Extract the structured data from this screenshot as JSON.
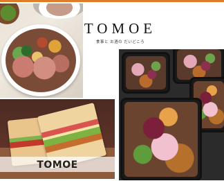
{
  "brand": {
    "name": "TOMOE",
    "tagline": "食事と お酒の だいどころ",
    "accent": "#e07b27"
  },
  "photos": {
    "bowl": {
      "alt": "roast beef bowl"
    },
    "sandwich": {
      "alt": "sandwich",
      "watermark": "TOMOE"
    },
    "bento_boxes": {
      "alt": "bento boxes"
    }
  }
}
